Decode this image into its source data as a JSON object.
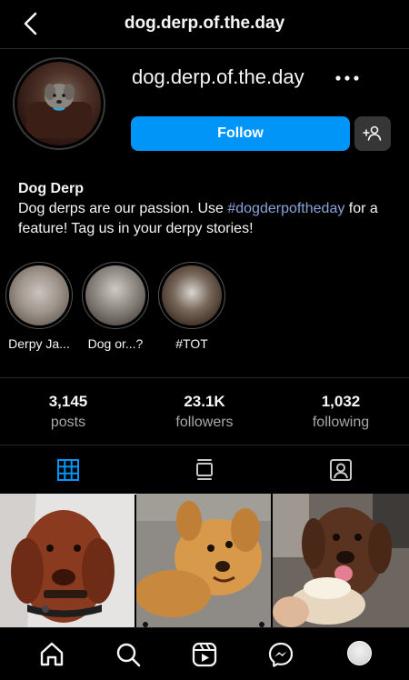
{
  "header": {
    "title": "dog.derp.of.the.day"
  },
  "profile": {
    "username": "dog.derp.of.the.day",
    "follow_label": "Follow"
  },
  "bio": {
    "name": "Dog Derp",
    "text_before": "Dog derps are our passion. Use ",
    "hashtag": "#dogderpoftheday",
    "text_after": " for a feature! Tag us in your derpy stories!"
  },
  "highlights": [
    {
      "label": "Derpy Ja..."
    },
    {
      "label": "Dog or...?"
    },
    {
      "label": "#TOT"
    }
  ],
  "stats": [
    {
      "value": "3,145",
      "label": "posts"
    },
    {
      "value": "23.1K",
      "label": "followers"
    },
    {
      "value": "1,032",
      "label": "following"
    }
  ],
  "tabs": [
    "grid-icon",
    "reels-icon",
    "tagged-icon"
  ],
  "nav": [
    "home-icon",
    "search-icon",
    "reels-icon",
    "messenger-icon",
    "profile-avatar"
  ],
  "colors": {
    "accent": "#0095f6",
    "hashtag": "#8aa3d9",
    "background": "#000000"
  }
}
